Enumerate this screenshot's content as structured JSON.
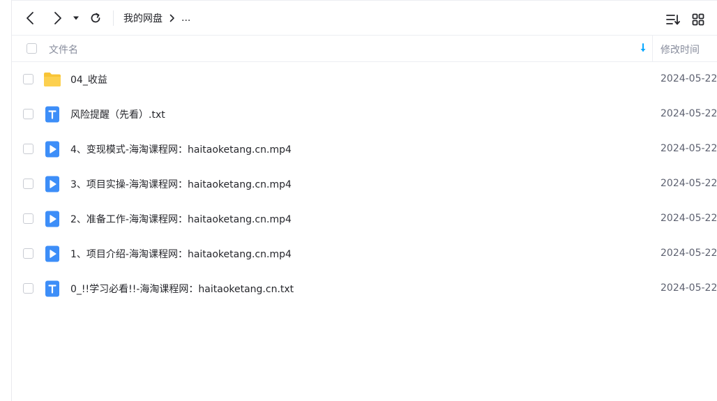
{
  "toolbar": {
    "breadcrumb_root": "我的网盘",
    "breadcrumb_ellipsis": "..."
  },
  "table": {
    "col_name": "文件名",
    "col_time": "修改时间"
  },
  "files": [
    {
      "name": "04_收益",
      "type": "folder",
      "icon": "folder-icon",
      "time": "2024-05-22"
    },
    {
      "name": "风险提醒（先看）.txt",
      "type": "txt",
      "icon": "text-file-icon",
      "time": "2024-05-22"
    },
    {
      "name": "4、变现模式-海淘课程网：haitaoketang.cn.mp4",
      "type": "video",
      "icon": "video-file-icon",
      "time": "2024-05-22"
    },
    {
      "name": "3、项目实操-海淘课程网：haitaoketang.cn.mp4",
      "type": "video",
      "icon": "video-file-icon",
      "time": "2024-05-22"
    },
    {
      "name": "2、准备工作-海淘课程网：haitaoketang.cn.mp4",
      "type": "video",
      "icon": "video-file-icon",
      "time": "2024-05-22"
    },
    {
      "name": "1、项目介绍-海淘课程网：haitaoketang.cn.mp4",
      "type": "video",
      "icon": "video-file-icon",
      "time": "2024-05-22"
    },
    {
      "name": "0_!!学习必看!!-海淘课程网：haitaoketang.cn.txt",
      "type": "txt",
      "icon": "text-file-icon",
      "time": "2024-05-22"
    }
  ],
  "colors": {
    "folder": "#f8c436",
    "file_blue": "#3d8ef8",
    "accent": "#06a7ff"
  }
}
